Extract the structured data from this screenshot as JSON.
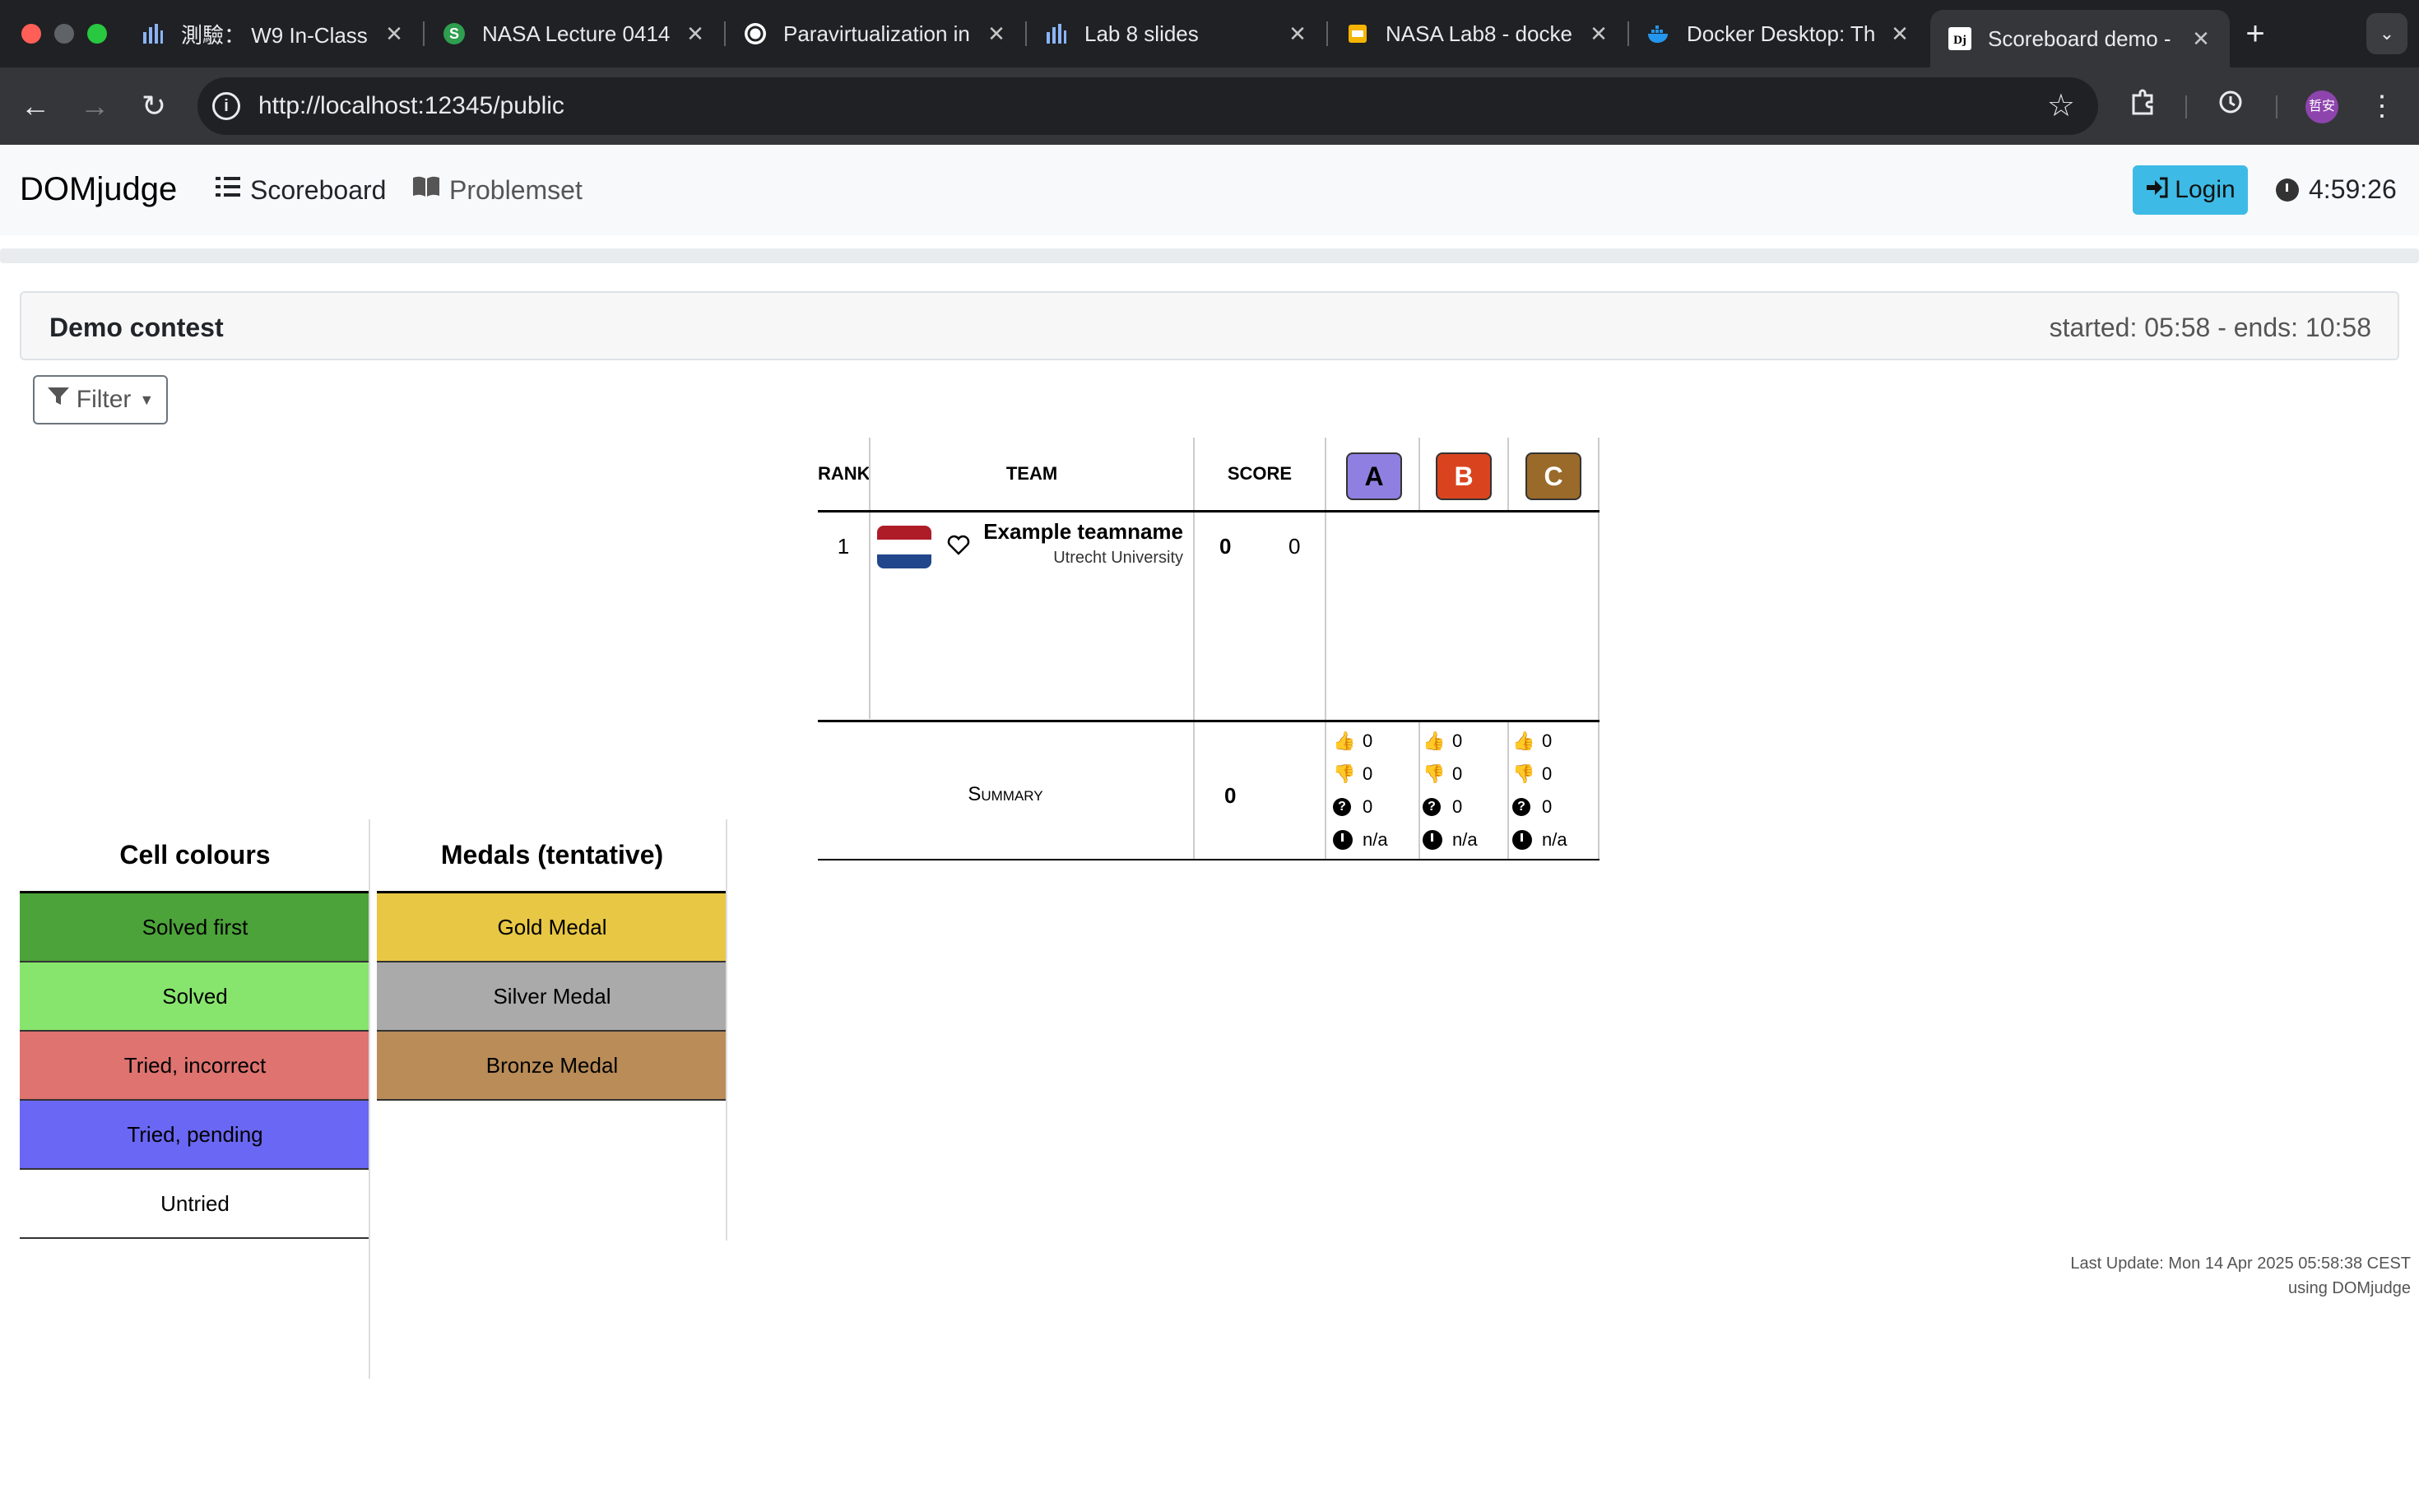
{
  "browser": {
    "tabs": [
      {
        "title": "測驗： W9 In-Class",
        "icon": "bar-chart-icon"
      },
      {
        "title": "NASA Lecture 0414",
        "icon": "slides-s-icon"
      },
      {
        "title": "Paravirtualization in",
        "icon": "openai-icon"
      },
      {
        "title": "Lab 8 slides",
        "icon": "bar-chart-icon"
      },
      {
        "title": "NASA Lab8 - docke",
        "icon": "google-slides-icon"
      },
      {
        "title": "Docker Desktop: Th",
        "icon": "docker-icon"
      },
      {
        "title": "Scoreboard demo -",
        "icon": "domjudge-icon"
      }
    ],
    "url": "http://localhost:12345/public",
    "profile_initials": "哲安"
  },
  "nav": {
    "brand": "DOMjudge",
    "scoreboard": "Scoreboard",
    "problemset": "Problemset",
    "login": "Login",
    "clock": "4:59:26"
  },
  "contest": {
    "name": "Demo contest",
    "times": "started: 05:58 - ends: 10:58"
  },
  "filter_label": "Filter",
  "scoreboard": {
    "headers": {
      "rank": "RANK",
      "team": "TEAM",
      "score": "SCORE"
    },
    "problems": [
      {
        "label": "A",
        "color": "#8e7fe0"
      },
      {
        "label": "B",
        "color": "#d9441f"
      },
      {
        "label": "C",
        "color": "#9a6a2a"
      }
    ],
    "rows": [
      {
        "rank": "1",
        "team": "Example teamname",
        "affiliation": "Utrecht University",
        "solved": "0",
        "time": "0"
      }
    ],
    "summary": {
      "label": "Summary",
      "score": "0",
      "problems": [
        {
          "correct": "0",
          "incorrect": "0",
          "pending": "0",
          "first": "n/a"
        },
        {
          "correct": "0",
          "incorrect": "0",
          "pending": "0",
          "first": "n/a"
        },
        {
          "correct": "0",
          "incorrect": "0",
          "pending": "0",
          "first": "n/a"
        }
      ]
    }
  },
  "legend_cells": {
    "title": "Cell colours",
    "items": [
      {
        "label": "Solved first",
        "color": "#4ca33a"
      },
      {
        "label": "Solved",
        "color": "#87e56d"
      },
      {
        "label": "Tried, incorrect",
        "color": "#de7370"
      },
      {
        "label": "Tried, pending",
        "color": "#6a67f4"
      },
      {
        "label": "Untried",
        "color": "#ffffff"
      }
    ]
  },
  "legend_medals": {
    "title": "Medals (tentative)",
    "items": [
      {
        "label": "Gold Medal",
        "color": "#e8c744"
      },
      {
        "label": "Silver Medal",
        "color": "#aaaaaa"
      },
      {
        "label": "Bronze Medal",
        "color": "#b98c58"
      }
    ]
  },
  "footer": {
    "last_update": "Last Update: Mon 14 Apr 2025 05:58:38 CEST",
    "using": "using DOMjudge"
  }
}
